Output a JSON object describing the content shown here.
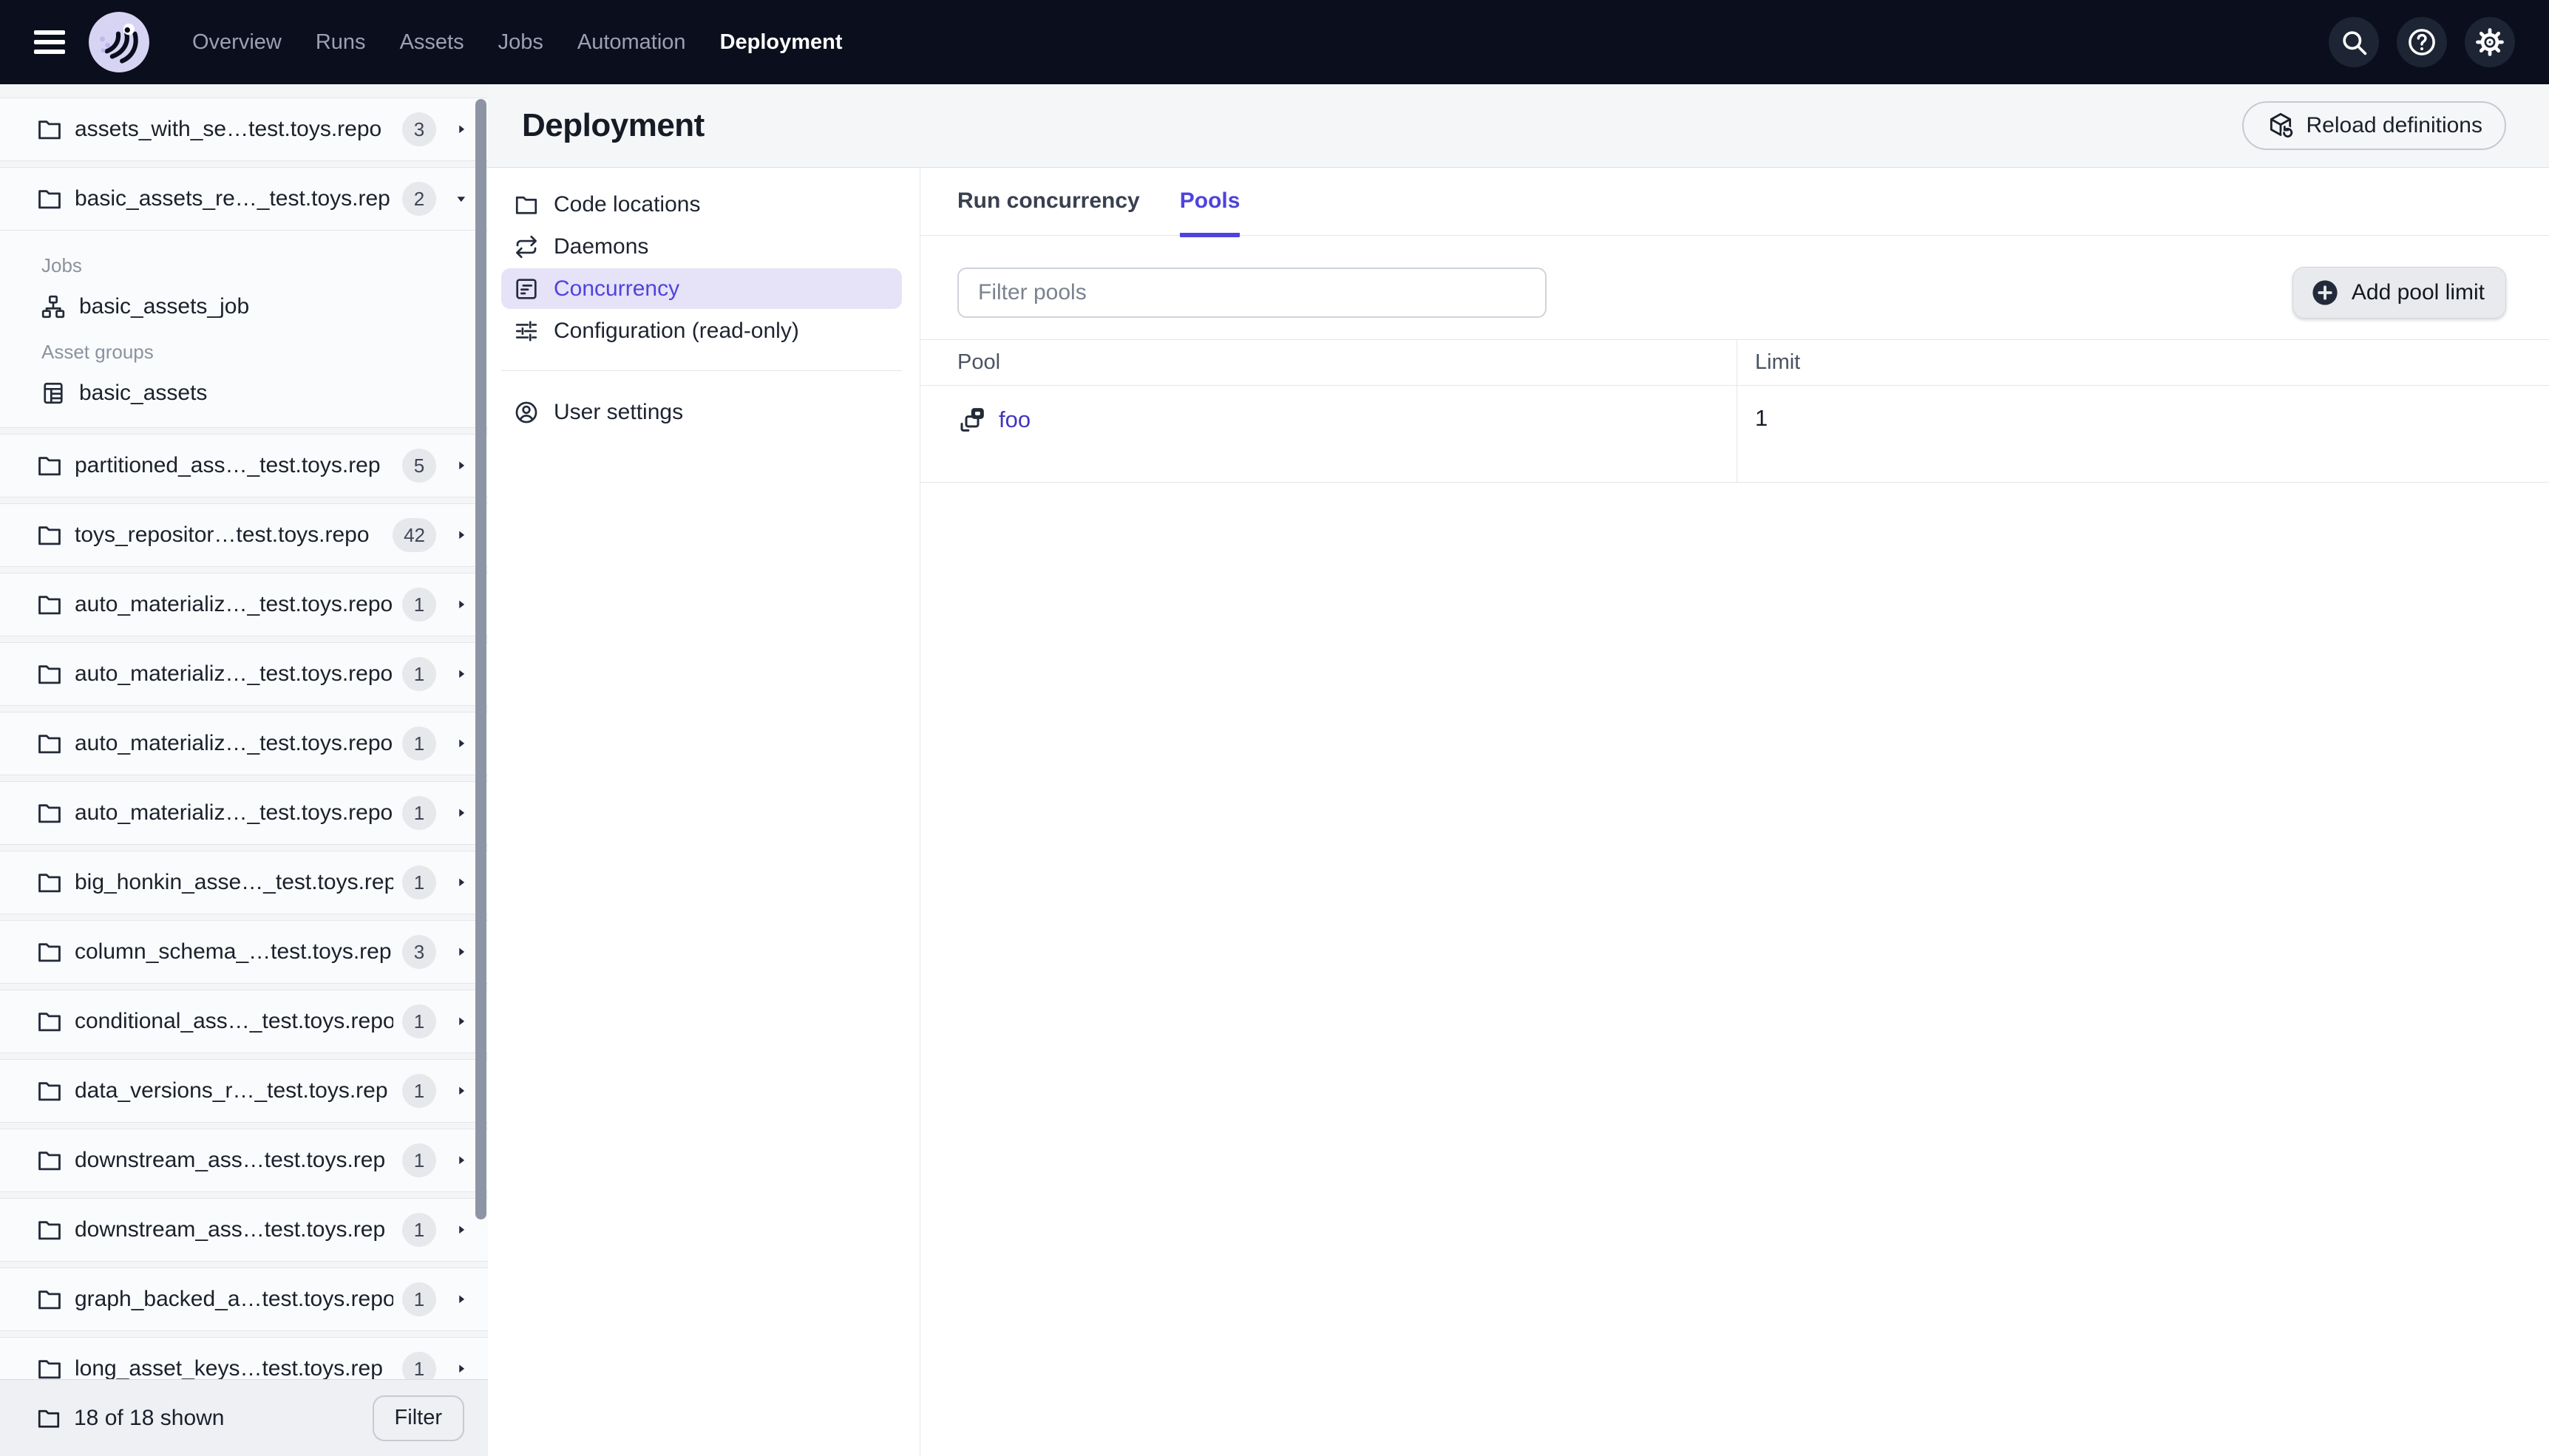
{
  "topnav": {
    "nav_items": [
      {
        "label": "Overview",
        "active": false
      },
      {
        "label": "Runs",
        "active": false
      },
      {
        "label": "Assets",
        "active": false
      },
      {
        "label": "Jobs",
        "active": false
      },
      {
        "label": "Automation",
        "active": false
      },
      {
        "label": "Deployment",
        "active": true
      }
    ],
    "actions": [
      {
        "name": "search-icon"
      },
      {
        "name": "help-icon"
      },
      {
        "name": "settings-gear-icon"
      }
    ]
  },
  "sidebar": {
    "rows": [
      {
        "label": "assets_with_se…test.toys.repo",
        "count": "3",
        "expanded": false
      },
      {
        "label": "basic_assets_re…_test.toys.rep",
        "count": "2",
        "expanded": true,
        "sections": [
          {
            "title": "Jobs",
            "items": [
              {
                "icon": "job-icon",
                "label": "basic_assets_job"
              }
            ]
          },
          {
            "title": "Asset groups",
            "items": [
              {
                "icon": "asset-group-icon",
                "label": "basic_assets"
              }
            ]
          }
        ]
      },
      {
        "label": "partitioned_ass…_test.toys.rep",
        "count": "5",
        "expanded": false
      },
      {
        "label": "toys_repositor…test.toys.repo",
        "count": "42",
        "expanded": false
      },
      {
        "label": "auto_materializ…_test.toys.repo",
        "count": "1",
        "expanded": false
      },
      {
        "label": "auto_materializ…_test.toys.repo",
        "count": "1",
        "expanded": false
      },
      {
        "label": "auto_materializ…_test.toys.repo",
        "count": "1",
        "expanded": false
      },
      {
        "label": "auto_materializ…_test.toys.repo",
        "count": "1",
        "expanded": false
      },
      {
        "label": "big_honkin_asse…_test.toys.rep",
        "count": "1",
        "expanded": false
      },
      {
        "label": "column_schema_…test.toys.rep",
        "count": "3",
        "expanded": false
      },
      {
        "label": "conditional_ass…_test.toys.repo",
        "count": "1",
        "expanded": false
      },
      {
        "label": "data_versions_r…_test.toys.rep",
        "count": "1",
        "expanded": false
      },
      {
        "label": "downstream_ass…test.toys.rep",
        "count": "1",
        "expanded": false
      },
      {
        "label": "downstream_ass…test.toys.rep",
        "count": "1",
        "expanded": false
      },
      {
        "label": "graph_backed_a…test.toys.repo",
        "count": "1",
        "expanded": false
      },
      {
        "label": "long_asset_keys…test.toys.rep",
        "count": "1",
        "expanded": false
      }
    ],
    "footer": {
      "summary": "18 of 18 shown",
      "filter_button": "Filter"
    }
  },
  "page": {
    "title": "Deployment",
    "reload_button": "Reload definitions"
  },
  "settings_nav": {
    "items": [
      {
        "label": "Code locations",
        "icon": "folder-icon",
        "selected": false
      },
      {
        "label": "Daemons",
        "icon": "daemons-icon",
        "selected": false
      },
      {
        "label": "Concurrency",
        "icon": "concurrency-icon",
        "selected": true
      },
      {
        "label": "Configuration (read-only)",
        "icon": "sliders-icon",
        "selected": false
      }
    ],
    "secondary_items": [
      {
        "label": "User settings",
        "icon": "user-icon",
        "selected": false
      }
    ]
  },
  "concurrency": {
    "tabs": [
      {
        "label": "Run concurrency",
        "active": false
      },
      {
        "label": "Pools",
        "active": true
      }
    ],
    "filter_placeholder": "Filter pools",
    "add_button": "Add pool limit",
    "table": {
      "columns": [
        "Pool",
        "Limit"
      ],
      "rows": [
        {
          "pool": "foo",
          "limit": "1"
        }
      ]
    }
  },
  "colors": {
    "accent": "#4f43dd",
    "accent_bg": "#e6e2f8",
    "topbar_bg": "#0a0e1d",
    "link": "#4036c0"
  }
}
